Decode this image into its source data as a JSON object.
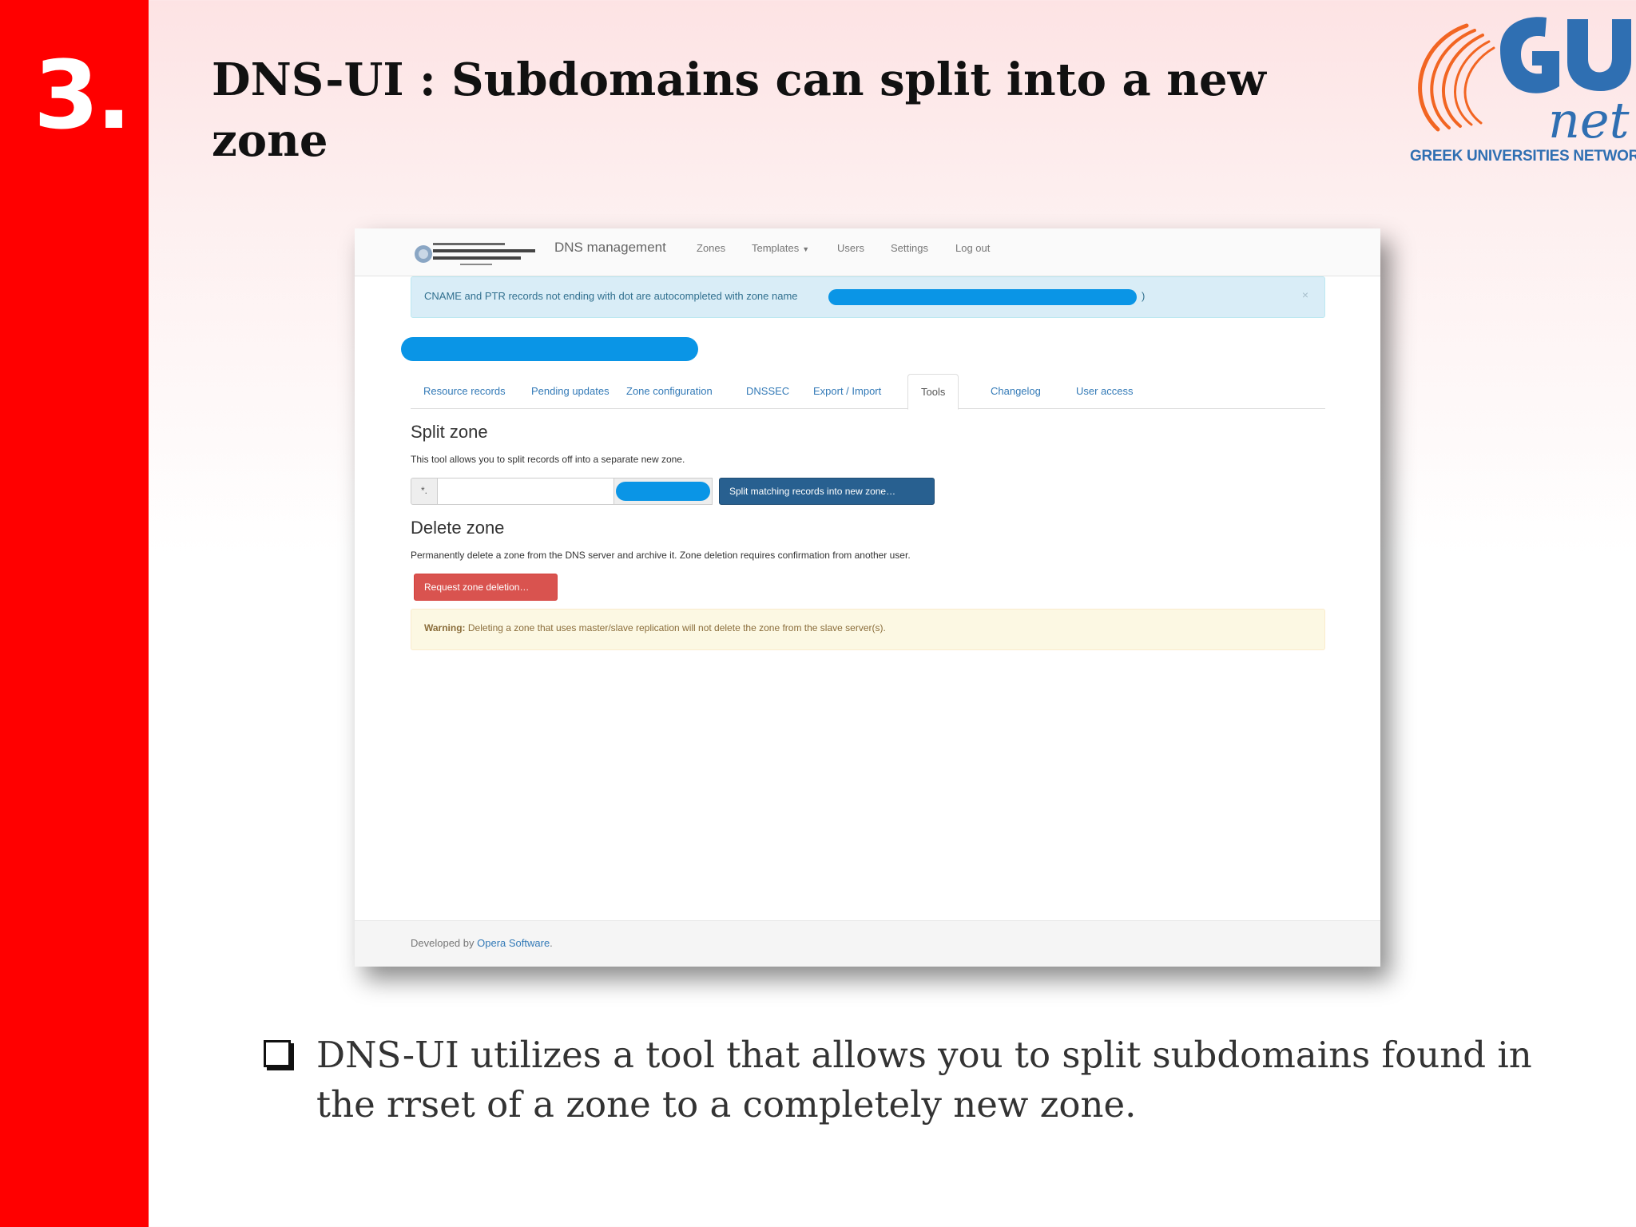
{
  "slide": {
    "number": "3.",
    "title": "DNS-UI : Subdomains can split into a new zone",
    "logo_text": "GREEK UNIVERSITIES NETWORK",
    "logo_icon": "grnet-logo-icon",
    "bullet_text": "DNS-UI utilizes a tool that allows you to split subdomains found in the rrset of a zone to a completely new zone.",
    "colors": {
      "accent_red": "#ff0000",
      "logo_blue": "#2f6fb2",
      "logo_orange": "#f26522"
    }
  },
  "app": {
    "brand": "DNS management",
    "nav": {
      "zones": "Zones",
      "templates": "Templates",
      "users": "Users",
      "settings": "Settings",
      "logout": "Log out"
    },
    "info_alert": "CNAME and PTR records not ending with dot are autocompleted with zone name",
    "info_alert_suffix": ")",
    "close": "×",
    "tabs": [
      "Resource records",
      "Pending updates",
      "Zone configuration",
      "DNSSEC",
      "Export / Import",
      "Tools",
      "Changelog",
      "User access"
    ],
    "active_tab": "Tools",
    "split": {
      "heading": "Split zone",
      "description": "This tool allows you to split records off into a separate new zone.",
      "prefix": "*.",
      "value": "",
      "button": "Split matching records into new zone…"
    },
    "delete": {
      "heading": "Delete zone",
      "description": "Permanently delete a zone from the DNS server and archive it. Zone deletion requires confirmation from another user.",
      "button": "Request zone deletion…"
    },
    "warning": {
      "label": "Warning:",
      "text": "Deleting a zone that uses master/slave replication will not delete the zone from the slave server(s)."
    },
    "footer": {
      "prefix": "Developed by",
      "link": "Opera Software",
      "suffix": "."
    }
  }
}
